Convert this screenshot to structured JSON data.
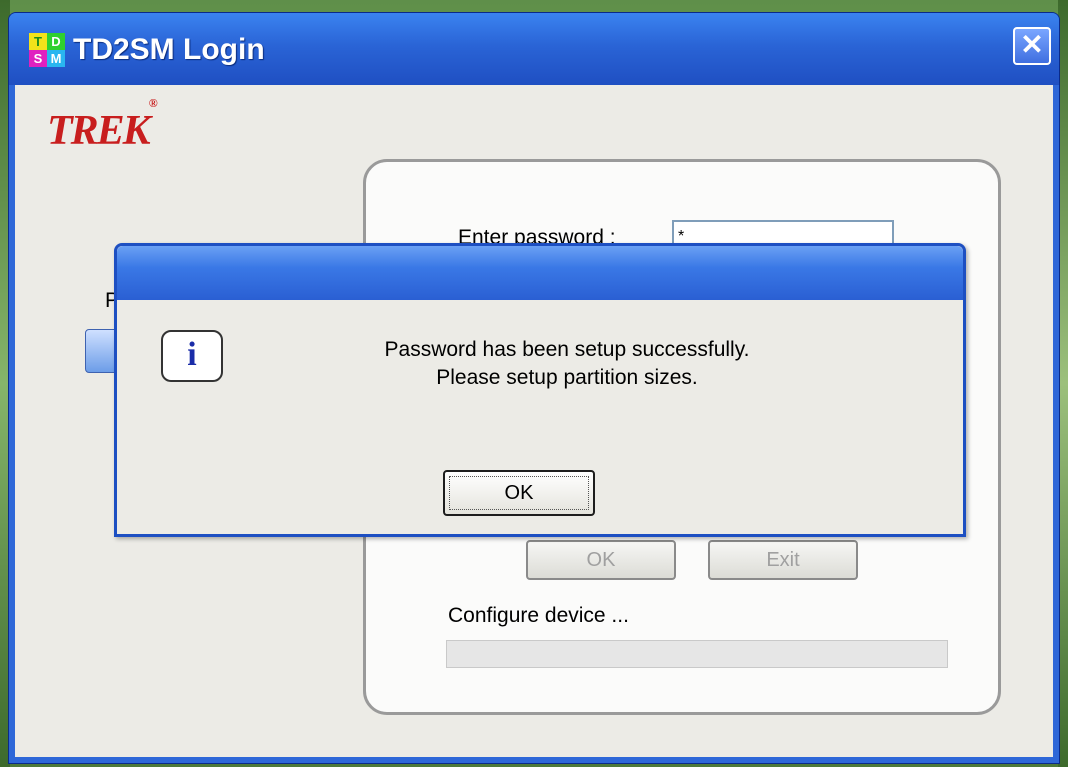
{
  "window": {
    "title": "TD2SM Login",
    "close_glyph": "✕",
    "app_icon_letters": [
      "T",
      "D",
      "S",
      "M"
    ]
  },
  "logo": {
    "text": "TREK",
    "mark": "®"
  },
  "login": {
    "password_label": "Enter password :",
    "password_value": "*",
    "ok_label": "OK",
    "exit_label": "Exit",
    "status_label": "Configure device ...",
    "left_partial_label": "P"
  },
  "dialog": {
    "icon": "info-icon",
    "icon_glyph": "i",
    "message_line1": "Password has been setup successfully.",
    "message_line2": "Please setup partition sizes.",
    "ok_label": "OK"
  },
  "colors": {
    "titlebar": "#2a64d6",
    "logo": "#c81e1e",
    "info_icon": "#1a2ca8"
  }
}
